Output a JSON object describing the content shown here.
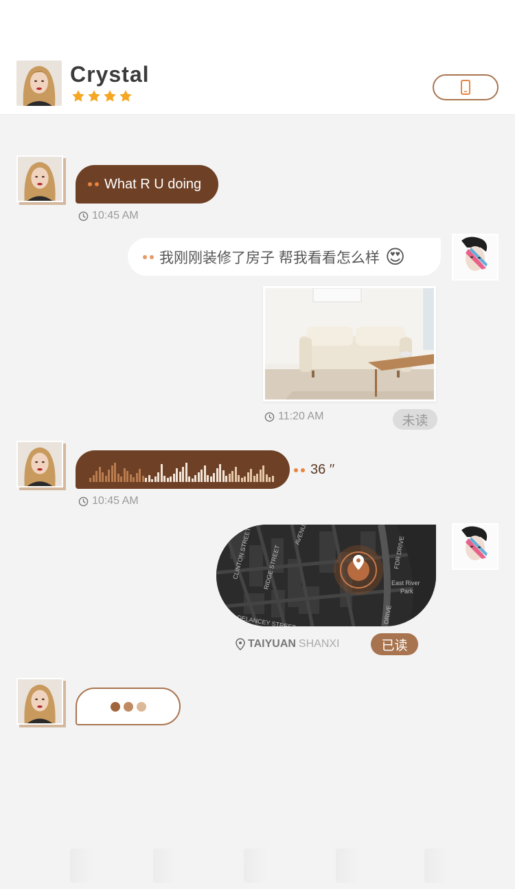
{
  "header": {
    "name": "Crystal",
    "rating": 4,
    "phone_icon": "phone-icon"
  },
  "messages": [
    {
      "id": "m1",
      "side": "left",
      "type": "text",
      "text": "What R U doing",
      "time": "10:45 AM"
    },
    {
      "id": "m2",
      "side": "right",
      "type": "text",
      "text": "我刚刚装修了房子 帮我看看怎么样",
      "emoji": "😍"
    },
    {
      "id": "m3",
      "side": "right",
      "type": "image",
      "image": "living-room-photo",
      "time": "11:20 AM",
      "status": "未读"
    },
    {
      "id": "m4",
      "side": "left",
      "type": "voice",
      "duration": "36 ′′",
      "time": "10:45 AM"
    },
    {
      "id": "m5",
      "side": "right",
      "type": "location",
      "map_labels": [
        "CLINTON STREET",
        "RIDGE STREET",
        "AVENUE",
        "FDR DRIVE",
        "East River",
        "Park",
        "DELANCEY STREET",
        "DRIVE"
      ],
      "city": "TAIYUAN",
      "province": "SHANXI",
      "status": "已读"
    },
    {
      "id": "m6",
      "side": "left",
      "type": "typing"
    }
  ],
  "colors": {
    "brand_dark": "#6e4025",
    "brand_light": "#a8744f",
    "accent_orange": "#e8843f",
    "star": "#f5a623",
    "badge_unread_bg": "#dcdcdc",
    "badge_read_bg": "#a8744f"
  }
}
